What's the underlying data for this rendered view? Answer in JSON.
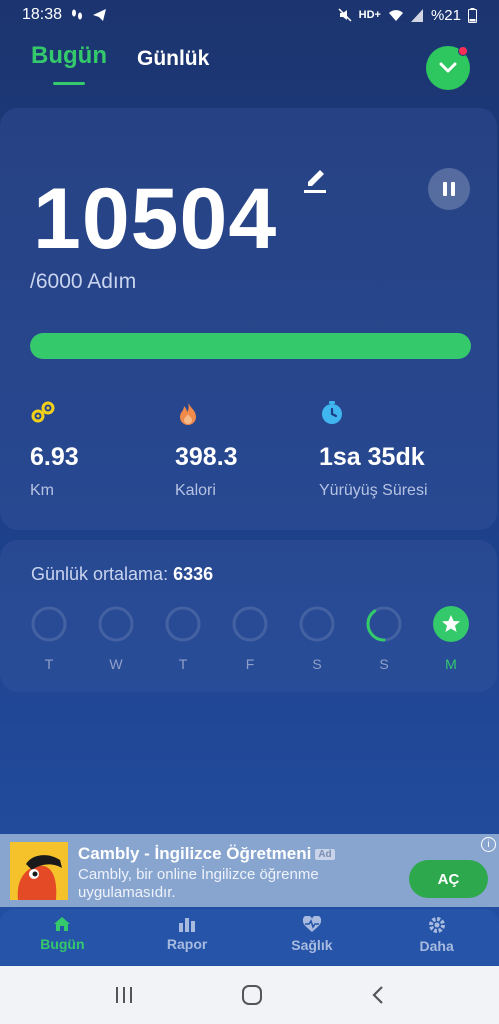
{
  "status_bar": {
    "time": "18:38",
    "network": "HD+",
    "battery": "%21"
  },
  "tabs": [
    {
      "label": "Bugün",
      "active": true
    },
    {
      "label": "Günlük",
      "active": false
    }
  ],
  "today": {
    "steps": "10504",
    "goal_text": "/6000 Adım",
    "progress": 1.0,
    "stats": [
      {
        "value": "6.93",
        "label": "Km",
        "icon": "distance-icon",
        "color": "#f2d11b"
      },
      {
        "value": "398.3",
        "label": "Kalori",
        "icon": "flame-icon",
        "color": "#f08a4b"
      },
      {
        "value": "1sa 35dk",
        "label": "Yürüyüş Süresi",
        "icon": "timer-icon",
        "color": "#3fb6ef"
      }
    ]
  },
  "weekly": {
    "avg_label": "Günlük ortalama:",
    "avg_value": "6336",
    "days": [
      {
        "label": "T",
        "fraction": 0
      },
      {
        "label": "W",
        "fraction": 0
      },
      {
        "label": "T",
        "fraction": 0
      },
      {
        "label": "F",
        "fraction": 0
      },
      {
        "label": "S",
        "fraction": 0
      },
      {
        "label": "S",
        "fraction": 0.4
      },
      {
        "label": "M",
        "fraction": 1,
        "goal_reached": true
      }
    ]
  },
  "ad": {
    "title": "Cambly - İngilizce Öğretmeni",
    "badge": "Ad",
    "description": "Cambly, bir online İngilizce öğrenme uygulamasıdır.",
    "cta": "AÇ",
    "info": "i"
  },
  "bottom_nav": [
    {
      "label": "Bugün",
      "icon": "home-icon",
      "active": true
    },
    {
      "label": "Rapor",
      "icon": "bar-chart-icon",
      "active": false
    },
    {
      "label": "Sağlık",
      "icon": "heart-pulse-icon",
      "active": false
    },
    {
      "label": "Daha",
      "icon": "gear-icon",
      "active": false
    }
  ],
  "colors": {
    "accent": "#34c96b",
    "background": "#1d3e86"
  }
}
